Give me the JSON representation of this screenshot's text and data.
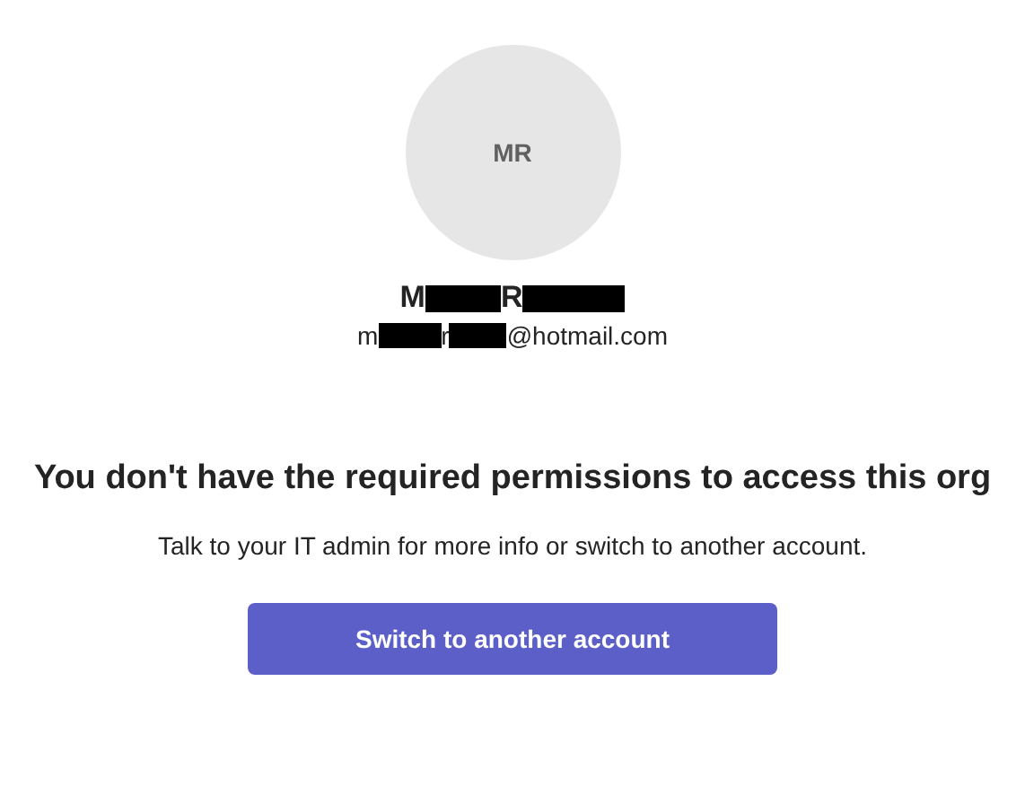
{
  "avatar": {
    "initials": "MR"
  },
  "name": [
    {
      "kind": "text",
      "text": "M"
    },
    {
      "kind": "redacted"
    },
    {
      "kind": "text",
      "text": "R"
    },
    {
      "kind": "redacted"
    }
  ],
  "email": [
    {
      "kind": "text",
      "text": "m"
    },
    {
      "kind": "redacted"
    },
    {
      "kind": "text",
      "text": "r"
    },
    {
      "kind": "redacted"
    },
    {
      "kind": "text",
      "text": "@hotmail.com"
    }
  ],
  "heading": "You don't have the required permissions to access this org",
  "message": "Talk to your IT admin for more info or switch to another account.",
  "button": "Switch to another account"
}
